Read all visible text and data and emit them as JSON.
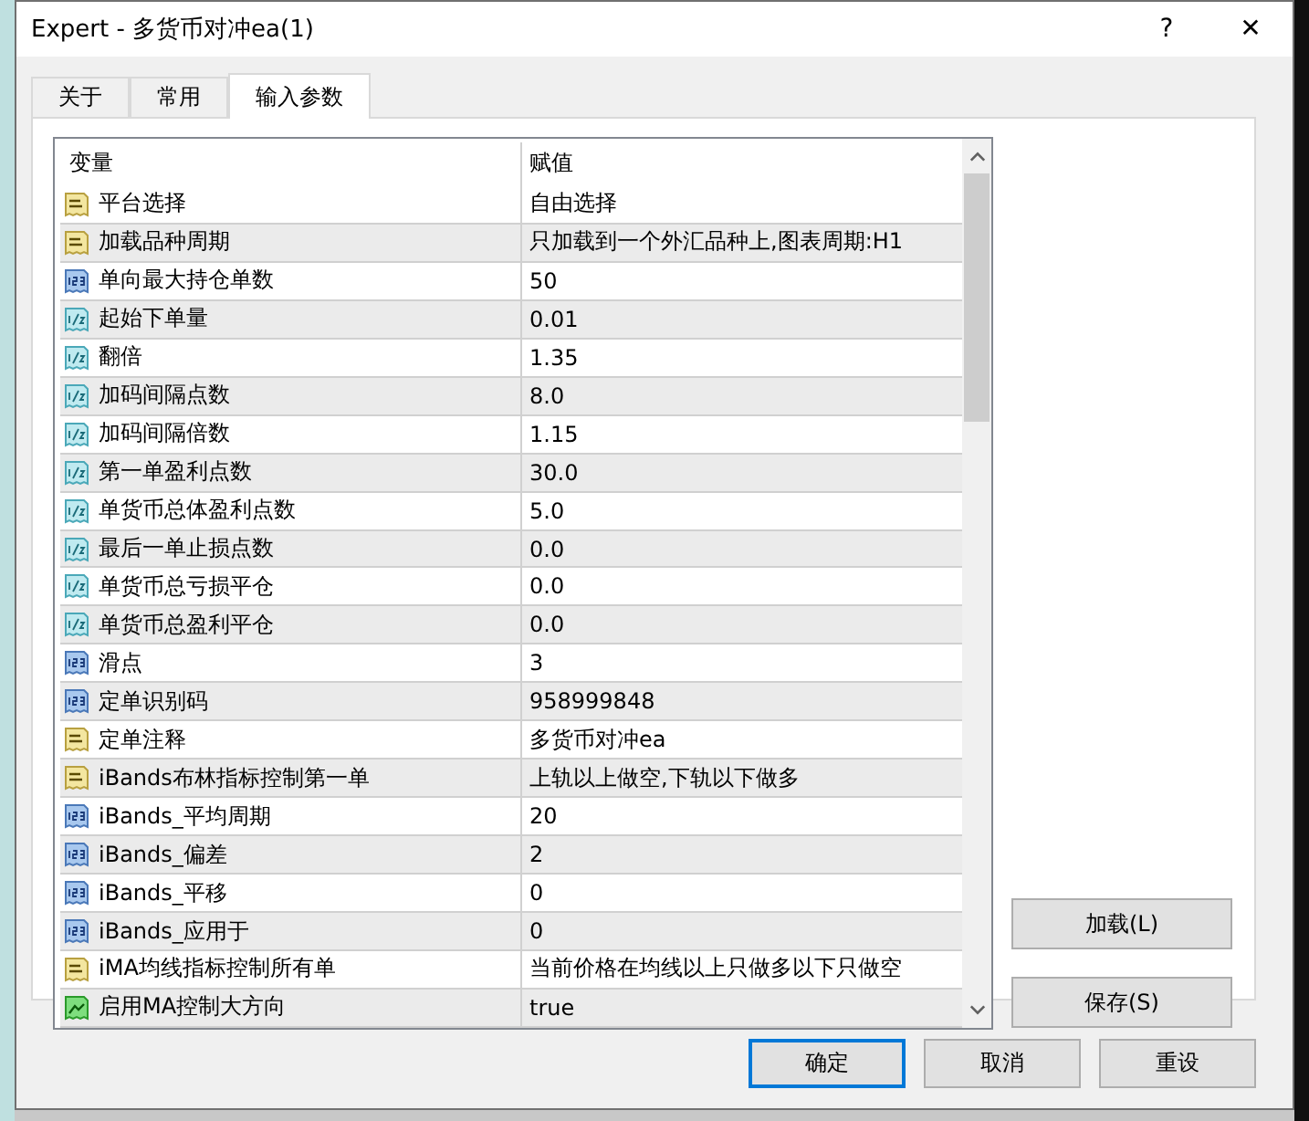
{
  "window": {
    "title": "Expert - 多货币对冲ea(1)",
    "help": "?",
    "close": "✕"
  },
  "tabs": [
    {
      "label": "关于",
      "selected": false
    },
    {
      "label": "常用",
      "selected": false
    },
    {
      "label": "输入参数",
      "selected": true
    }
  ],
  "table": {
    "columns": [
      "变量",
      "赋值"
    ],
    "rows": [
      {
        "kind": "string",
        "name": "平台选择",
        "value": "自由选择"
      },
      {
        "kind": "string",
        "name": "加载品种周期",
        "value": "只加载到一个外汇品种上,图表周期:H1"
      },
      {
        "kind": "int",
        "name": "单向最大持仓单数",
        "value": "50"
      },
      {
        "kind": "double",
        "name": "起始下单量",
        "value": "0.01"
      },
      {
        "kind": "double",
        "name": "翻倍",
        "value": "1.35"
      },
      {
        "kind": "double",
        "name": "加码间隔点数",
        "value": "8.0"
      },
      {
        "kind": "double",
        "name": "加码间隔倍数",
        "value": "1.15"
      },
      {
        "kind": "double",
        "name": "第一单盈利点数",
        "value": "30.0"
      },
      {
        "kind": "double",
        "name": "单货币总体盈利点数",
        "value": "5.0"
      },
      {
        "kind": "double",
        "name": "最后一单止损点数",
        "value": "0.0"
      },
      {
        "kind": "double",
        "name": "单货币总亏损平仓",
        "value": "0.0"
      },
      {
        "kind": "double",
        "name": "单货币总盈利平仓",
        "value": "0.0"
      },
      {
        "kind": "int",
        "name": "滑点",
        "value": "3"
      },
      {
        "kind": "int",
        "name": "定单识别码",
        "value": "958999848"
      },
      {
        "kind": "string",
        "name": "定单注释",
        "value": "多货币对冲ea"
      },
      {
        "kind": "string",
        "name": "iBands布林指标控制第一单",
        "value": "上轨以上做空,下轨以下做多"
      },
      {
        "kind": "int",
        "name": "iBands_平均周期",
        "value": "20"
      },
      {
        "kind": "int",
        "name": "iBands_偏差",
        "value": "2"
      },
      {
        "kind": "int",
        "name": "iBands_平移",
        "value": "0"
      },
      {
        "kind": "int",
        "name": "iBands_应用于",
        "value": "0"
      },
      {
        "kind": "string",
        "name": "iMA均线指标控制所有单",
        "value": "当前价格在均线以上只做多以下只做空"
      },
      {
        "kind": "bool",
        "name": "启用MA控制大方向",
        "value": "true"
      }
    ]
  },
  "side_buttons": [
    "加载(L)",
    "保存(S)"
  ],
  "buttons": [
    {
      "label": "确定",
      "focused": true
    },
    {
      "label": "取消",
      "focused": false
    },
    {
      "label": "重设",
      "focused": false
    }
  ]
}
